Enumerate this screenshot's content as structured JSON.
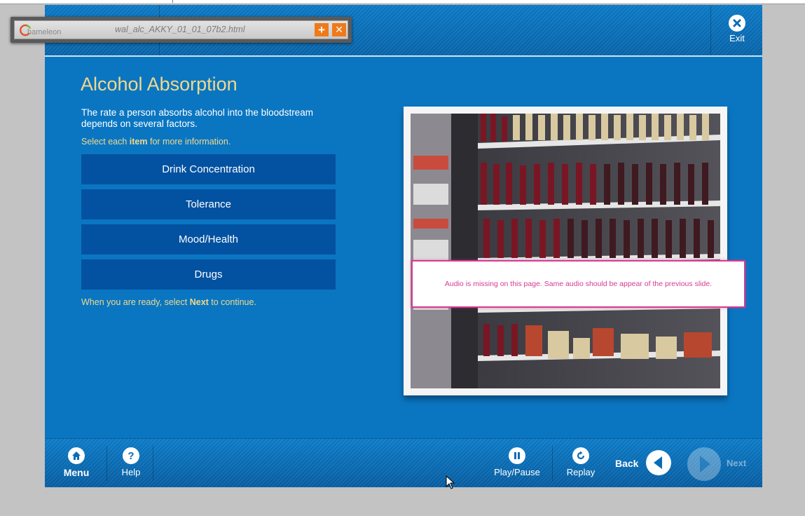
{
  "extension_bar": {
    "logo_text": "hameleon",
    "filename": "wal_alc_AKKY_01_01_07b2.html",
    "add_icon": "plus-icon",
    "close_icon": "close-icon"
  },
  "header": {
    "exit_label": "Exit"
  },
  "content": {
    "title": "Alcohol Absorption",
    "intro": "The rate a person absorbs alcohol into the bloodstream depends on several factors.",
    "instruction_pre": "Select each ",
    "instruction_bold": "item",
    "instruction_post": " for more information.",
    "items": [
      {
        "label": "Drink Concentration"
      },
      {
        "label": "Tolerance"
      },
      {
        "label": "Mood/Health"
      },
      {
        "label": "Drugs"
      }
    ],
    "continue_pre": "When you are ready, select ",
    "continue_bold": "Next",
    "continue_post": " to continue."
  },
  "audio_note": "Audio is missing on this page. Same audio should be appear of the previous slide.",
  "footer": {
    "menu_label": "Menu",
    "help_label": "Help",
    "play_pause_label": "Play/Pause",
    "replay_label": "Replay",
    "back_label": "Back",
    "next_label": "Next"
  },
  "colors": {
    "course_blue": "#0a76c2",
    "item_button": "#0352a1",
    "title_gold": "#f2d88b",
    "note_pink": "#d63a92",
    "extension_orange": "#ef7a1a"
  }
}
